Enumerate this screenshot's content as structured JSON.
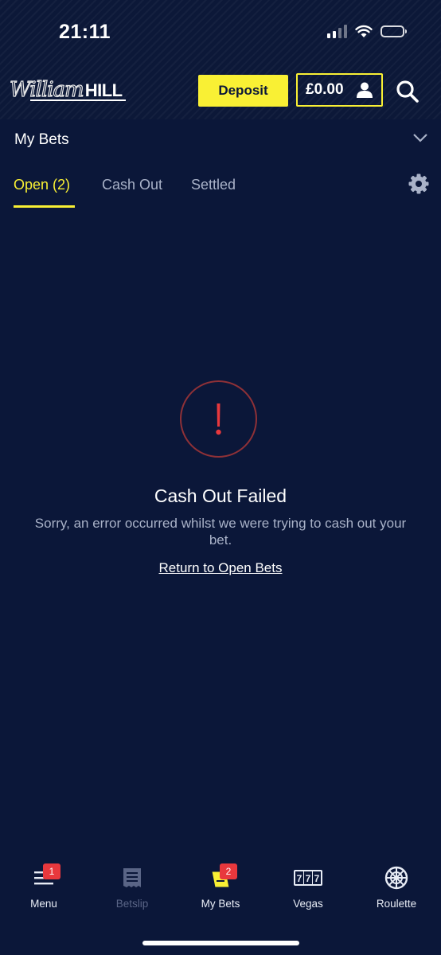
{
  "status_bar": {
    "time": "21:11"
  },
  "header": {
    "logo_script": "William",
    "logo_block": "HILL",
    "deposit_label": "Deposit",
    "balance": "£0.00"
  },
  "my_bets": {
    "title": "My Bets",
    "tabs": [
      {
        "label": "Open (2)",
        "active": true
      },
      {
        "label": "Cash Out",
        "active": false
      },
      {
        "label": "Settled",
        "active": false
      }
    ]
  },
  "error": {
    "title": "Cash Out Failed",
    "message": "Sorry, an error occurred whilst we were trying to cash out your bet.",
    "link": "Return to Open Bets"
  },
  "bottom_nav": [
    {
      "label": "Menu",
      "icon": "menu-icon",
      "badge": "1",
      "disabled": false
    },
    {
      "label": "Betslip",
      "icon": "betslip-icon",
      "badge": "",
      "disabled": true
    },
    {
      "label": "My Bets",
      "icon": "mybets-icon",
      "badge": "2",
      "disabled": false
    },
    {
      "label": "Vegas",
      "icon": "slot-machine-icon",
      "badge": "",
      "disabled": false
    },
    {
      "label": "Roulette",
      "icon": "roulette-wheel-icon",
      "badge": "",
      "disabled": false
    }
  ],
  "colors": {
    "background": "#0b1739",
    "accent_yellow": "#f9f034",
    "error_red": "#e8383d",
    "muted_text": "#a9b2c8"
  }
}
